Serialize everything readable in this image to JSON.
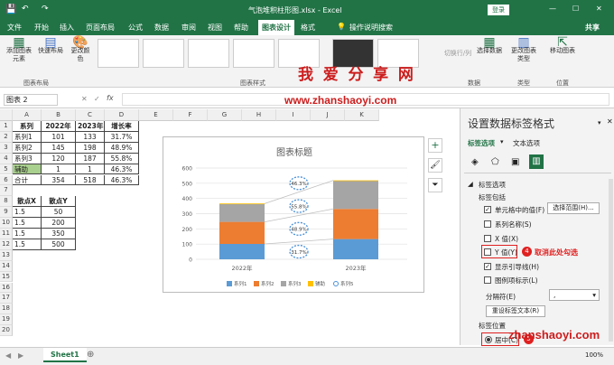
{
  "titlebar": {
    "filename": "气泡堆积柱形图.xlsx - Excel",
    "login": "登录",
    "min": "—",
    "max": "☐",
    "close": "✕"
  },
  "tabs": [
    "文件",
    "开始",
    "插入",
    "页面布局",
    "公式",
    "数据",
    "审阅",
    "视图",
    "帮助",
    "图表设计",
    "格式"
  ],
  "tell_me": "操作说明搜索",
  "share": "共享",
  "ribbon": {
    "add_element": "添加图表元素",
    "quick_layout": "快速布局",
    "change_color": "更改颜色",
    "group_layout": "图表布局",
    "group_styles": "图表样式",
    "switch_rowcol": "切换行/列",
    "select_data": "选择数据",
    "group_data": "数据",
    "change_type": "更改图表类型",
    "group_type": "类型",
    "move_chart": "移动图表",
    "group_location": "位置"
  },
  "formula_bar": {
    "namebox": "图表 2",
    "fx": "fx"
  },
  "columns": [
    "A",
    "B",
    "C",
    "D",
    "E",
    "F",
    "G",
    "H",
    "I",
    "J",
    "K"
  ],
  "rows": [
    "1",
    "2",
    "3",
    "4",
    "5",
    "6",
    "7",
    "8",
    "9",
    "10",
    "11",
    "12",
    "13",
    "14",
    "15",
    "16",
    "17",
    "18",
    "19",
    "20"
  ],
  "table1": {
    "header": [
      "系列",
      "2022年",
      "2023年",
      "增长率"
    ],
    "rows": [
      [
        "系列1",
        "101",
        "133",
        "31.7%"
      ],
      [
        "系列2",
        "145",
        "198",
        "48.9%"
      ],
      [
        "系列3",
        "120",
        "187",
        "55.8%"
      ],
      [
        "辅助",
        "1",
        "1",
        "46.3%"
      ],
      [
        "合计",
        "354",
        "518",
        "46.3%"
      ]
    ]
  },
  "table2": {
    "header": [
      "散点X",
      "散点Y"
    ],
    "rows": [
      [
        "1.5",
        "50"
      ],
      [
        "1.5",
        "200"
      ],
      [
        "1.5",
        "350"
      ],
      [
        "1.5",
        "500"
      ]
    ]
  },
  "chart_data": {
    "type": "bar",
    "title": "图表标题",
    "categories": [
      "2022年",
      "2023年"
    ],
    "ylim": [
      0,
      600
    ],
    "yticks": [
      "0",
      "100",
      "200",
      "300",
      "400",
      "500",
      "600"
    ],
    "series": [
      {
        "name": "系列1",
        "values": [
          101,
          133
        ],
        "color": "#5b9bd5"
      },
      {
        "name": "系列2",
        "values": [
          145,
          198
        ],
        "color": "#ed7d31"
      },
      {
        "name": "系列3",
        "values": [
          120,
          187
        ],
        "color": "#a5a5a5"
      },
      {
        "name": "辅助",
        "values": [
          1,
          1
        ],
        "color": "#ffc000"
      }
    ],
    "bubble_labels": [
      "46.3%",
      "55.8%",
      "48.9%",
      "31.7%"
    ],
    "bubble_y": [
      500,
      350,
      200,
      50
    ],
    "legend": [
      "系列1",
      "系列2",
      "系列3",
      "辅助",
      "系列5"
    ],
    "legend_colors": [
      "#5b9bd5",
      "#ed7d31",
      "#a5a5a5",
      "#ffc000",
      "#4a90d9"
    ]
  },
  "pane": {
    "title": "设置数据标签格式",
    "tab_label_options": "标签选项",
    "tab_text_options": "文本选项",
    "section": "标签选项",
    "contains": "标签包括",
    "opt_cell_value": "单元格中的值(F)",
    "select_range": "选择范围(H)...",
    "opt_series_name": "系列名称(S)",
    "opt_x": "X 值(X)",
    "opt_y": "Y 值(Y)",
    "opt_leader": "显示引导线(H)",
    "opt_legend_key": "图例项标示(L)",
    "separator": "分隔符(E)",
    "separator_value": ",",
    "reset": "重设标签文本(R)",
    "position": "标签位置",
    "center": "居中(C)",
    "annot4_num": "4",
    "annot4_text": "取消此处勾选",
    "annot5_num": "5"
  },
  "status": {
    "sheet": "Sheet1",
    "zoom": "100%"
  },
  "watermark": {
    "cn": "我 爱 分 享 网",
    "url": "www.zhanshaoyi.com",
    "url2": "zhanshaoyi.com"
  }
}
